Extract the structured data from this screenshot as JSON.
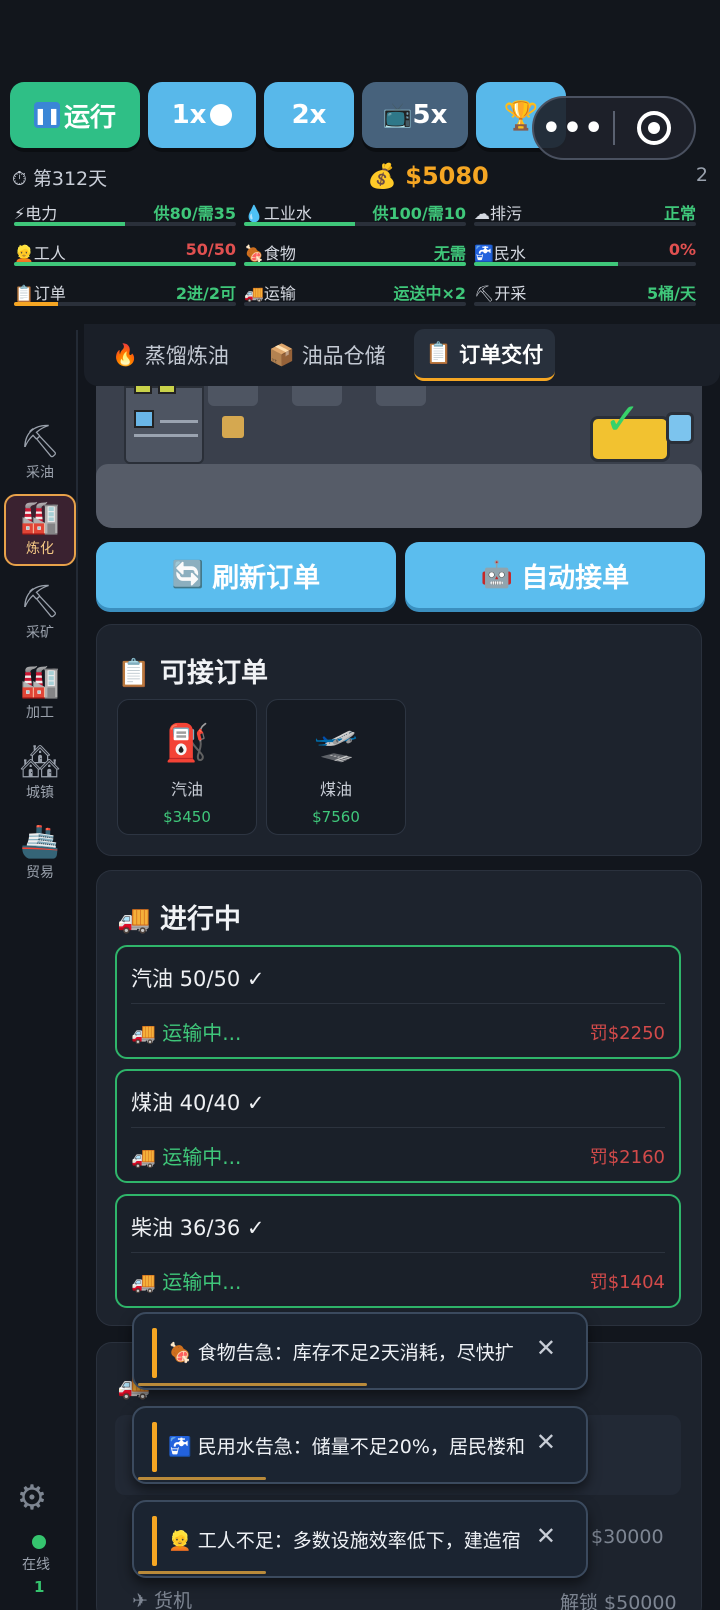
{
  "toolbar": {
    "run_label": "运行",
    "speed1_label": "1x",
    "speed2_label": "2x",
    "speed5_label": "5x",
    "trophy_icon": "🏆",
    "tv_icon": "📺"
  },
  "status": {
    "day": "第312天",
    "money": "$5080",
    "count": "2"
  },
  "stats": [
    {
      "icon": "⚡",
      "label": "电力",
      "value": "供80/需35",
      "color": "#3fc77a",
      "fill": 0.5,
      "fillColor": "#3fc77a"
    },
    {
      "icon": "💧",
      "label": "工业水",
      "value": "供100/需10",
      "color": "#3fc77a",
      "fill": 0.5,
      "fillColor": "#3fc77a"
    },
    {
      "icon": "☁",
      "label": "排污",
      "value": "正常",
      "color": "#3fc77a",
      "fill": 0,
      "fillColor": "#3fc77a"
    },
    {
      "icon": "👱",
      "label": "工人",
      "value": "50/50",
      "color": "#e05050",
      "fill": 1.0,
      "fillColor": "#3fc77a"
    },
    {
      "icon": "🍖",
      "label": "食物",
      "value": "无需",
      "color": "#3fc77a",
      "fill": 1.0,
      "fillColor": "#3fc77a"
    },
    {
      "icon": "🚰",
      "label": "民水",
      "value": "0%",
      "color": "#e05050",
      "fill": 0.65,
      "fillColor": "#3fc77a"
    },
    {
      "icon": "📋",
      "label": "订单",
      "value": "2进/2可",
      "color": "#3fc77a",
      "fill": 0.2,
      "fillColor": "#f5a623"
    },
    {
      "icon": "🚚",
      "label": "运输",
      "value": "运送中×2",
      "color": "#3fc77a",
      "fill": 0,
      "fillColor": "#3fc77a"
    },
    {
      "icon": "⛏",
      "label": "开采",
      "value": "5桶/天",
      "color": "#3fc77a",
      "fill": 0,
      "fillColor": "#3fc77a"
    }
  ],
  "sidebar": {
    "items": [
      {
        "icon": "⛏",
        "label": "采油"
      },
      {
        "icon": "🏭",
        "label": "炼化"
      },
      {
        "icon": "⛏",
        "label": "采矿"
      },
      {
        "icon": "🏭",
        "label": "加工"
      },
      {
        "icon": "🏘",
        "label": "城镇"
      },
      {
        "icon": "🚢",
        "label": "贸易"
      }
    ],
    "online_label": "在线",
    "online_count": "1"
  },
  "tabs": [
    {
      "icon": "🔥",
      "label": "蒸馏炼油"
    },
    {
      "icon": "📦",
      "label": "油品仓储"
    },
    {
      "icon": "📋",
      "label": "订单交付"
    }
  ],
  "actions": {
    "refresh_label": "刷新订单",
    "refresh_icon": "🔄",
    "auto_label": "自动接单",
    "auto_icon": "🤖"
  },
  "available": {
    "title": "可接订单",
    "title_icon": "📋",
    "orders": [
      {
        "icon": "⛽",
        "name": "汽油",
        "price": "$3450"
      },
      {
        "icon": "🛫",
        "name": "煤油",
        "price": "$7560"
      }
    ]
  },
  "in_progress": {
    "title": "进行中",
    "title_icon": "🚚",
    "orders": [
      {
        "name": "汽油 50/50 ✓",
        "status": "🚚 运输中...",
        "penalty": "罚$2250"
      },
      {
        "name": "煤油 40/40 ✓",
        "status": "🚚 运输中...",
        "penalty": "罚$2160"
      },
      {
        "name": "柴油 36/36 ✓",
        "status": "🚚 运输中...",
        "penalty": "罚$1404"
      }
    ]
  },
  "lower": {
    "title_icon": "🚚",
    "lock1": "锁 $30000",
    "vehicle_icon": "✈",
    "vehicle": "货机",
    "lock2": "解锁 $50000"
  },
  "toasts": [
    {
      "icon": "🍖",
      "text": "食物告急：库存不足2天消耗，尽快扩",
      "progress": 0.52
    },
    {
      "icon": "🚰",
      "text": "民用水告急：储量不足20%，居民楼和",
      "progress": 0.29
    },
    {
      "icon": "👱",
      "text": "工人不足：多数设施效率低下，建造宿",
      "progress": 0.29
    }
  ]
}
